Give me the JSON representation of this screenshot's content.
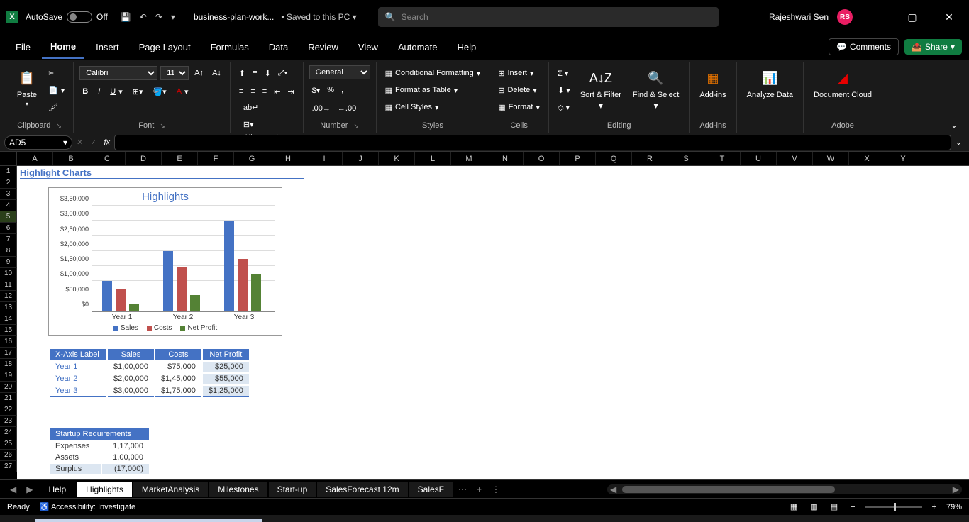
{
  "titlebar": {
    "autosave_label": "AutoSave",
    "autosave_state": "Off",
    "filename": "business-plan-work...",
    "saved_status": "Saved to this PC",
    "search_placeholder": "Search",
    "user_name": "Rajeshwari Sen",
    "user_initials": "RS"
  },
  "ribbon_tabs": [
    "File",
    "Home",
    "Insert",
    "Page Layout",
    "Formulas",
    "Data",
    "Review",
    "View",
    "Automate",
    "Help"
  ],
  "ribbon_active_tab": "Home",
  "comments_label": "Comments",
  "share_label": "Share",
  "ribbon": {
    "clipboard": {
      "paste": "Paste",
      "label": "Clipboard"
    },
    "font": {
      "name": "Calibri",
      "size": "11",
      "label": "Font"
    },
    "alignment": {
      "label": "Alignment"
    },
    "number": {
      "format": "General",
      "label": "Number"
    },
    "styles": {
      "cond_fmt": "Conditional Formatting",
      "format_table": "Format as Table",
      "cell_styles": "Cell Styles",
      "label": "Styles"
    },
    "cells": {
      "insert": "Insert",
      "delete": "Delete",
      "format": "Format",
      "label": "Cells"
    },
    "editing": {
      "sort": "Sort & Filter",
      "find": "Find & Select",
      "label": "Editing"
    },
    "addins": {
      "btn": "Add-ins",
      "label": "Add-ins"
    },
    "analyze": {
      "btn": "Analyze Data",
      "label": ""
    },
    "adobe": {
      "btn": "Document Cloud",
      "label": "Adobe"
    }
  },
  "name_box": "AD5",
  "columns": [
    "A",
    "B",
    "C",
    "D",
    "E",
    "F",
    "G",
    "H",
    "I",
    "J",
    "K",
    "L",
    "M",
    "N",
    "O",
    "P",
    "Q",
    "R",
    "S",
    "T",
    "U",
    "V",
    "W",
    "X",
    "Y"
  ],
  "rows": [
    1,
    2,
    3,
    4,
    5,
    6,
    7,
    8,
    9,
    10,
    11,
    12,
    13,
    14,
    15,
    16,
    17,
    18,
    19,
    20,
    21,
    22,
    23,
    24,
    25,
    26,
    27
  ],
  "selected_row": 5,
  "section_title": "Highlight Charts",
  "chart_data": {
    "type": "bar",
    "title": "Highlights",
    "categories": [
      "Year 1",
      "Year 2",
      "Year 3"
    ],
    "series": [
      {
        "name": "Sales",
        "values": [
          100000,
          200000,
          300000
        ],
        "color": "#4472c4"
      },
      {
        "name": "Costs",
        "values": [
          75000,
          145000,
          175000
        ],
        "color": "#c0504d"
      },
      {
        "name": "Net Profit",
        "values": [
          25000,
          55000,
          125000
        ],
        "color": "#548235"
      }
    ],
    "ylim": [
      0,
      350000
    ],
    "y_ticks": [
      "$0",
      "$50,000",
      "$1,00,000",
      "$1,50,000",
      "$2,00,000",
      "$2,50,000",
      "$3,00,000",
      "$3,50,000"
    ]
  },
  "data_table": {
    "headers": [
      "X-Axis Label",
      "Sales",
      "Costs",
      "Net Profit"
    ],
    "rows": [
      [
        "Year 1",
        "$1,00,000",
        "$75,000",
        "$25,000"
      ],
      [
        "Year 2",
        "$2,00,000",
        "$1,45,000",
        "$55,000"
      ],
      [
        "Year 3",
        "$3,00,000",
        "$1,75,000",
        "$1,25,000"
      ]
    ]
  },
  "startup_table": {
    "header": "Startup Requirements",
    "rows": [
      [
        "Expenses",
        "1,17,000"
      ],
      [
        "Assets",
        "1,00,000"
      ],
      [
        "Surplus",
        "(17,000)"
      ]
    ]
  },
  "sheet_tabs": [
    "Help",
    "Highlights",
    "MarketAnalysis",
    "Milestones",
    "Start-up",
    "SalesForecast 12m",
    "SalesF"
  ],
  "active_sheet": "Highlights",
  "status": {
    "ready": "Ready",
    "accessibility": "Accessibility: Investigate",
    "zoom": "79%"
  }
}
